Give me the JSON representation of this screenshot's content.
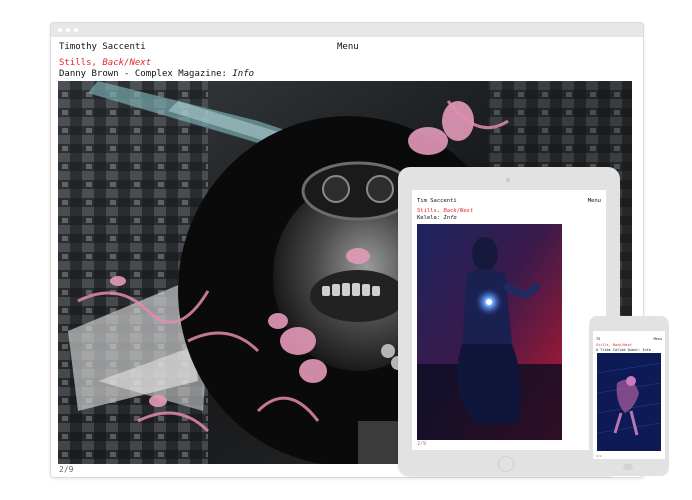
{
  "desktop": {
    "site_title": "Timothy Saccenti",
    "menu_label": "Menu",
    "nav_prefix": "Stills, ",
    "nav_links": "Back/Next",
    "caption_prefix": "Danny Brown - Complex Magazine: ",
    "caption_link": "Info",
    "counter": "2/9"
  },
  "tablet": {
    "site_title": "Tim Saccenti",
    "menu_label": "Menu",
    "nav_prefix": "Stills, ",
    "nav_links": "Back/Next",
    "caption_prefix": "Kelela: ",
    "caption_link": "Info",
    "counter": "2/9"
  },
  "phone": {
    "site_title": "TS",
    "menu_label": "Menu",
    "nav_label": "Stills, Back/Next",
    "caption": "A Tribe Called Quest: Info",
    "counter": "2/9"
  },
  "colors": {
    "accent_red": "#e3262b",
    "device_gray": "#e2e2e2",
    "hero_dark": "#0e0f10"
  }
}
